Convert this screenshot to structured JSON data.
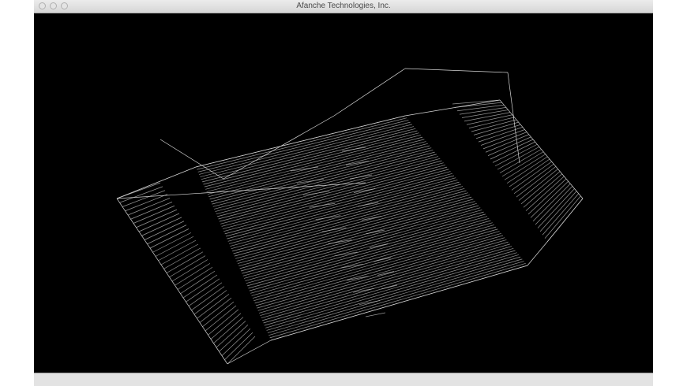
{
  "window": {
    "title": "Afanche Technologies, Inc."
  },
  "colors": {
    "wire": "#d8d8d8",
    "background": "#000000"
  }
}
